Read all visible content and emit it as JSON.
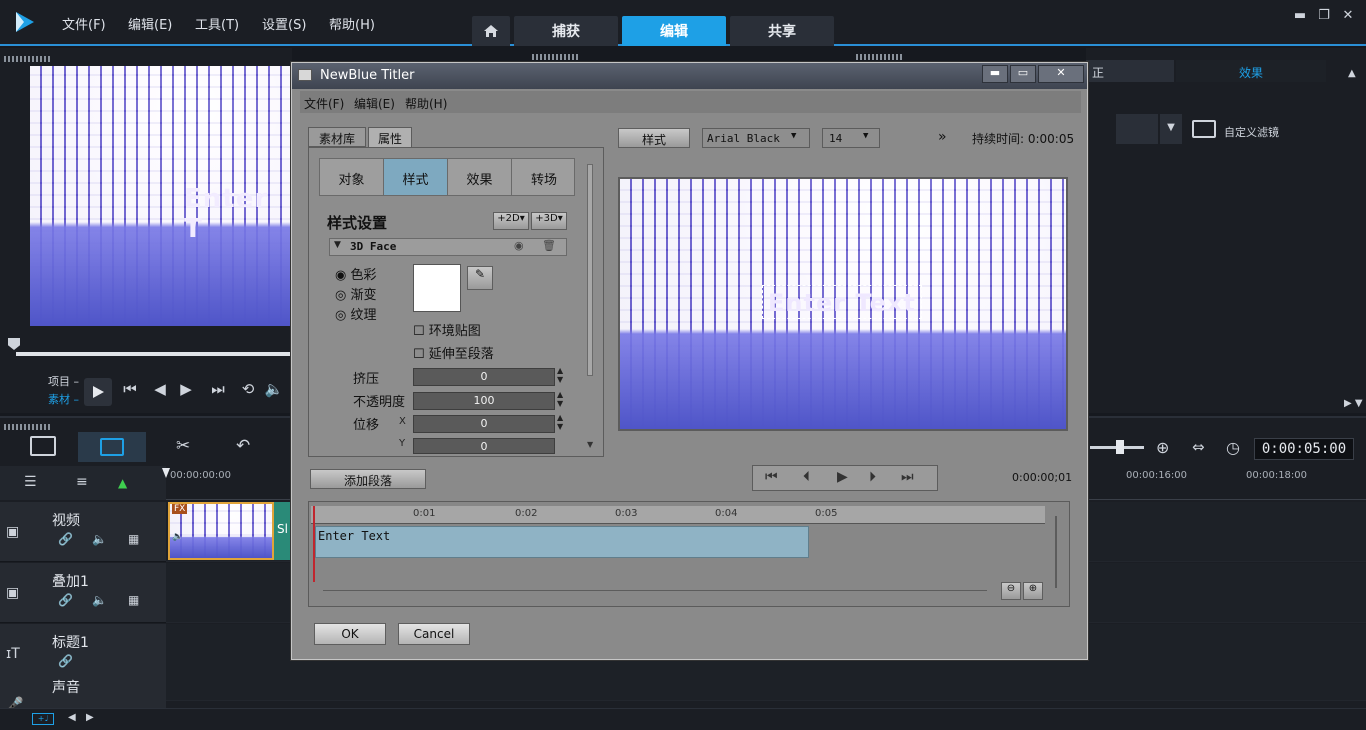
{
  "app": {
    "menus": [
      "文件(F)",
      "编辑(E)",
      "工具(T)",
      "设置(S)",
      "帮助(H)"
    ],
    "tabs": [
      "捕获",
      "编辑",
      "共享"
    ],
    "active_tab": "编辑"
  },
  "left_preview": {
    "overlay_text": "Enter T",
    "project_label": "项目",
    "clip_label": "素材"
  },
  "right_panel": {
    "partial_tab": "正",
    "effects_tab": "效果",
    "custom_filter": "自定义滤镜"
  },
  "timeline": {
    "timecode": "0:00:05:00",
    "ruler": [
      "00:00:00:00",
      "00:00:16:00",
      "00:00:18:00"
    ],
    "tracks": [
      {
        "name": "视频"
      },
      {
        "name": "叠加1"
      },
      {
        "name": "标题1"
      },
      {
        "name": "声音"
      }
    ],
    "clip_fx_badge": "FX",
    "clip_partial_label": "Sl"
  },
  "dialog": {
    "title": "NewBlue Titler",
    "menus": [
      "文件(F)",
      "编辑(E)",
      "帮助(H)"
    ],
    "panel_tabs": [
      "素材库",
      "属性"
    ],
    "sub_tabs": [
      "对象",
      "样式",
      "效果",
      "转场"
    ],
    "active_sub_tab": "样式",
    "style_settings_label": "样式设置",
    "add_2d": "+2D",
    "add_3d": "+3D",
    "face_section": "3D Face",
    "radio_options": [
      "色彩",
      "渐变",
      "纹理"
    ],
    "checkbox_env": "环境贴图",
    "checkbox_extend": "延伸至段落",
    "params": [
      {
        "label": "挤压",
        "value": "0"
      },
      {
        "label": "不透明度",
        "value": "100"
      },
      {
        "label": "位移",
        "axis": "X",
        "value": "0"
      },
      {
        "label": "",
        "axis": "Y",
        "value": "0"
      }
    ],
    "add_paragraph": "添加段落",
    "style_button": "样式",
    "font": "Arial Black",
    "font_size": "14",
    "more": "»",
    "duration_label": "持续时间: 0:00:05",
    "preview_text": "Enter Text",
    "current_time": "0:00:00;01",
    "ruler_marks": [
      "0:01",
      "0:02",
      "0:03",
      "0:04",
      "0:05"
    ],
    "timeline_clip": "Enter Text",
    "ok": "OK",
    "cancel": "Cancel"
  },
  "colors": {
    "accent": "#1ea0e6",
    "dialog_bg": "#8a8a8a",
    "track_clip": "#8fb3c5"
  }
}
